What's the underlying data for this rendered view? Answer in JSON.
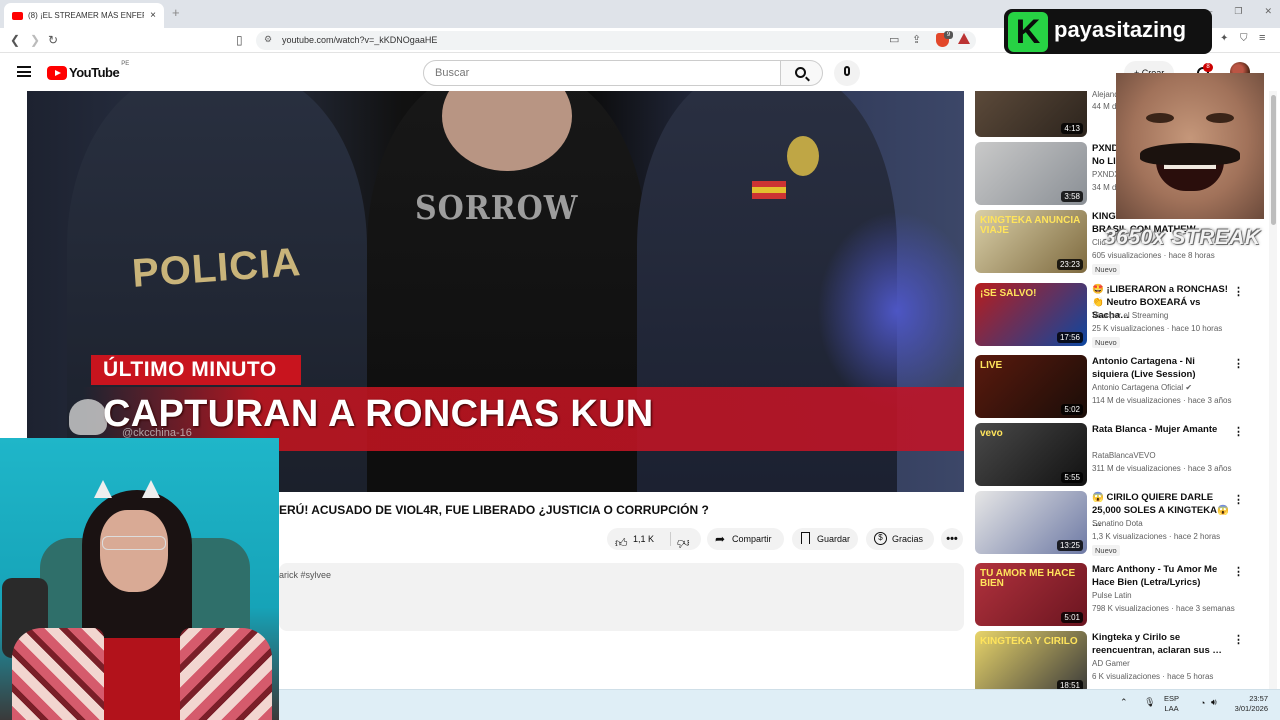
{
  "browser": {
    "tab_title": "(8) ¡EL STREAMER MÁS ENFERM",
    "tab_close": "×",
    "new_tab": "+",
    "url": "youtube.com/watch?v=_kKDNOgaaHE",
    "window_controls": [
      "—",
      "❐",
      "✕"
    ]
  },
  "youtube": {
    "logo_text": "YouTube",
    "country_code": "PE",
    "search_placeholder": "Buscar",
    "create_label": "+ Crear",
    "notifications_count": "8"
  },
  "video": {
    "banner_tag": "ÚLTIMO MINUTO",
    "banner_title": "CAPTURAN A RONCHAS KUN",
    "scene_text_policia": "POLICIA",
    "scene_text_shirt": "SORROW",
    "watermark": "@ckcchina-16",
    "title": "ERÚ! ACUSADO DE VIOL4R, FUE LIBERADO ¿JUSTICIA O CORRUPCIÓN ?",
    "likes": "1,1 K",
    "share_label": "Compartir",
    "save_label": "Guardar",
    "thanks_label": "Gracias",
    "more_label": "•••",
    "description_snippet": "arick #sylvee"
  },
  "sidebar": {
    "items": [
      {
        "title": "",
        "channel": "Alejand",
        "meta": "44 M d",
        "duration": "4:13",
        "thumb_colors": [
          "#5c4a3a",
          "#2c241d"
        ],
        "thumb_text": ""
      },
      {
        "title": "PXND\nNo Ll",
        "channel": "PXNDX",
        "meta": "34 M d",
        "duration": "3:58",
        "thumb_colors": [
          "#c9c9c9",
          "#8a8f95"
        ],
        "thumb_text": ""
      },
      {
        "title": "KINGTEKA ANUNCIA VIAJE A BRASIL CON MATHEW",
        "channel": "Clid",
        "meta": "605 visualizaciones · hace 8 horas",
        "duration": "23:23",
        "nuevo": "Nuevo",
        "thumb_colors": [
          "#d9cfa8",
          "#7e6a3f"
        ],
        "thumb_text": "KINGTEKA ANUNCIA VIAJE"
      },
      {
        "title": "🤩 ¡LIBERARON a RONCHAS! 👏 Neutro BOXEARÁ vs Sacha…",
        "channel": "Vivo por el Streaming",
        "meta": "25 K visualizaciones · hace 10 horas",
        "duration": "17:56",
        "nuevo": "Nuevo",
        "thumb_colors": [
          "#b71c1c",
          "#0d47a1"
        ],
        "thumb_text": "¡SE SALVO!"
      },
      {
        "title": "Antonio Cartagena - Ni siquiera (Live Session)",
        "channel": "Antonio Cartagena Oficial ✔",
        "meta": "114 M de visualizaciones · hace 3 años",
        "duration": "5:02",
        "thumb_colors": [
          "#5a1a0e",
          "#1a0d08"
        ],
        "thumb_text": "LIVE"
      },
      {
        "title": "Rata Blanca - Mujer Amante",
        "channel": "RataBlancaVEVO",
        "meta": "311 M de visualizaciones · hace 3 años",
        "duration": "5:55",
        "thumb_colors": [
          "#4a4a4a",
          "#111111"
        ],
        "thumb_text": "vevo"
      },
      {
        "title": "😱 CIRILO QUIERE DARLE 25,000 SOLES A KINGTEKA😱 …",
        "channel": "Senatino Dota",
        "meta": "1,3 K visualizaciones · hace 2 horas",
        "duration": "13:25",
        "nuevo": "Nuevo",
        "thumb_colors": [
          "#e6e6e6",
          "#6e7aa5"
        ],
        "thumb_text": ""
      },
      {
        "title": "Marc Anthony - Tu Amor Me Hace Bien (Letra/Lyrics)",
        "channel": "Pulse Latin",
        "meta": "798 K visualizaciones · hace 3 semanas",
        "duration": "5:01",
        "thumb_colors": [
          "#b1323d",
          "#6b1520"
        ],
        "thumb_text": "TU AMOR ME HACE BIEN"
      },
      {
        "title": "Kingteka y Cirilo se reencuentran, aclaran sus …",
        "channel": "AD Gamer",
        "meta": "6 K visualizaciones · hace 5 horas",
        "duration": "18:51",
        "thumb_colors": [
          "#e8d46a",
          "#3a3a3a"
        ],
        "thumb_text": "KINGTEKA Y CIRILO"
      }
    ]
  },
  "overlay": {
    "brand_initial": "K",
    "brand_name": "payasitazing",
    "streak_text": "3650x STREAK"
  },
  "taskbar": {
    "tray_icons": "⌃  🎙  ",
    "lang_top": "ESP",
    "lang_bottom": "LAA",
    "time": "23:57",
    "date": "3/01/2026"
  }
}
